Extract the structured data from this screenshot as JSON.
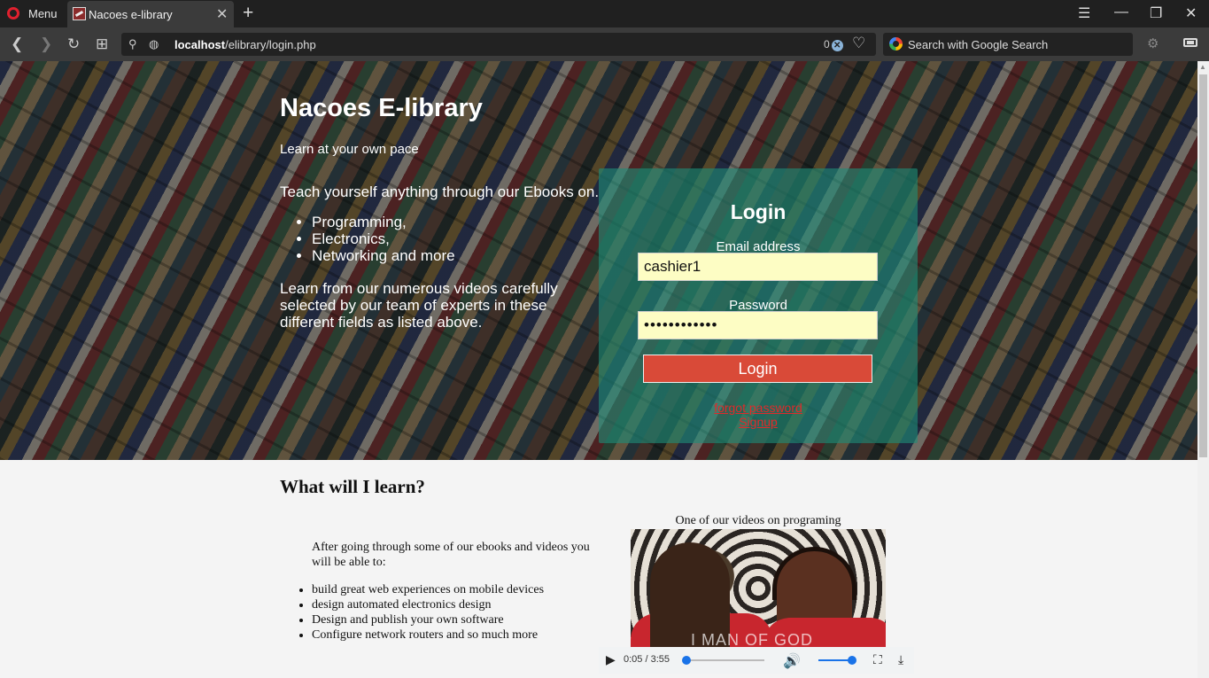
{
  "browser": {
    "menu_label": "Menu",
    "tab_title": "Nacoes e-library",
    "url_host": "localhost",
    "url_path": "/elibrary/login.php",
    "adblock_count": "0",
    "search_placeholder": "Search with Google Search"
  },
  "hero": {
    "site_title": "Nacoes E-library",
    "tagline": "Learn at your own pace",
    "intro": "Teach yourself anything through our Ebooks on.",
    "topics": [
      "Programming,",
      "Electronics,",
      "Networking and more"
    ],
    "videos_text": "Learn from our numerous videos carefully selected by our team of experts in these different fields as listed above."
  },
  "login": {
    "heading": "Login",
    "email_label": "Email address",
    "email_value": "cashier1",
    "password_label": "Password",
    "password_value": "••••••••••••",
    "button_label": "Login",
    "forgot_link": "forgot password",
    "signup_link": "Signup",
    "accent_color": "#d94a38"
  },
  "learn": {
    "title": "What will I learn?",
    "intro": "After going through some of our ebooks and videos you will be able to:",
    "items": [
      "build great web experiences on mobile devices",
      "design automated electronics design",
      "Design and publish your own software",
      "Configure network routers and so much more"
    ]
  },
  "video": {
    "caption": "One of our videos on programing",
    "overlay_text": "I MAN OF GOD",
    "time": "0:05 / 3:55",
    "progress_fraction": 0.021,
    "volume_fraction": 1.0
  }
}
